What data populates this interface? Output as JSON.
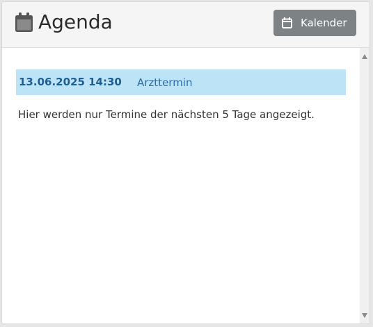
{
  "header": {
    "title": "Agenda",
    "title_icon": "calendar-icon",
    "calendar_button": {
      "label": "Kalender",
      "icon": "calendar-icon"
    }
  },
  "events": [
    {
      "datetime": "13.06.2025 14:30",
      "title": "Arzttermin"
    }
  ],
  "info_text": "Hier werden nur Termine der nächsten 5 Tage angezeigt.",
  "colors": {
    "header_bg": "#f5f5f5",
    "button_bg": "#7d8285",
    "event_highlight": "#bde3f6",
    "event_date": "#1d5f93",
    "event_title": "#2b6ca3"
  }
}
